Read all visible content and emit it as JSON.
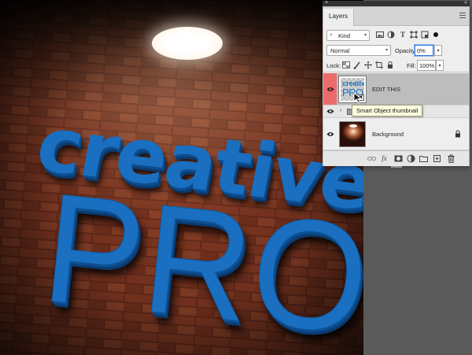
{
  "canvas": {
    "headline_line1": "creative",
    "headline_line2": "PRO",
    "text_color": "#1a6fc0"
  },
  "layers_panel": {
    "tab_label": "Layers",
    "filter": {
      "kind_value": "Kind",
      "icons": [
        "image-filter-icon",
        "adjustment-filter-icon",
        "type-filter-icon",
        "shape-filter-icon",
        "smart-object-filter-icon",
        "filter-toggle-dot"
      ]
    },
    "blend_mode": "Normal",
    "opacity_label": "Opacity:",
    "opacity_value": "0%",
    "lock_label": "Lock:",
    "lock_icons": [
      "lock-transparent-pixels-icon",
      "lock-image-pixels-icon",
      "lock-position-icon",
      "lock-artboard-icon",
      "lock-all-icon"
    ],
    "fill_label": "Fill:",
    "fill_value": "100%",
    "layers": [
      {
        "name": "EDIT THIS",
        "type": "smart-object",
        "visible": true,
        "selected": true
      },
      {
        "name": "",
        "type": "group",
        "visible": true,
        "selected": false
      },
      {
        "name": "Background",
        "type": "pixel",
        "visible": true,
        "locked": true
      }
    ],
    "tooltip": "Smart Object thumbnail",
    "footer_icons": [
      "link-layers-icon",
      "fx-icon",
      "add-mask-icon",
      "adjustment-layer-icon",
      "new-group-icon",
      "new-layer-icon",
      "delete-layer-icon"
    ]
  },
  "colors": {
    "panel_bg": "#eeeeee",
    "selected_row": "#bdbdbd",
    "eye_highlight": "#ec6b6b",
    "focus_blue": "#2f7bd9"
  }
}
